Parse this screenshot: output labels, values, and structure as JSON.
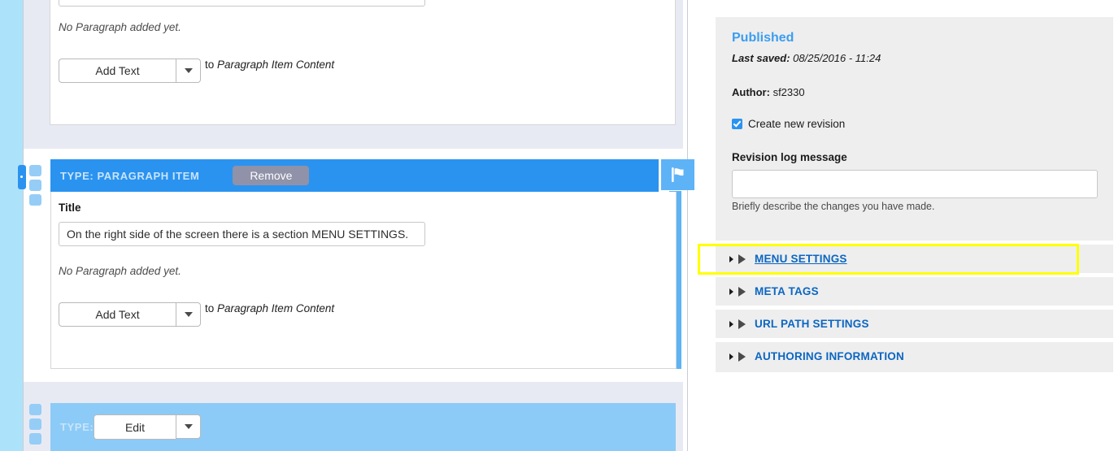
{
  "left_rail": {
    "icon": "drag-rail"
  },
  "main": {
    "top_card": {
      "top_input_value": "",
      "empty_notice": "No Paragraph added yet.",
      "add_button_label": "Add Text",
      "add_button_caret": "chevron-down-icon",
      "to_prefix": "to ",
      "to_target": "Paragraph Item Content"
    },
    "active_item": {
      "type_label": "TYPE: PARAGRAPH ITEM",
      "remove_label": "Remove",
      "flag_icon": "flag-icon",
      "title_field_label": "Title",
      "title_value": "On the right side of the screen there is a section MENU SETTINGS.",
      "empty_notice": "No Paragraph added yet.",
      "add_button_label": "Add Text",
      "add_button_caret": "chevron-down-icon",
      "to_prefix": "to ",
      "to_target": "Paragraph Item Content",
      "drag_handle_icon": "drag-handle-icon"
    },
    "bottom_item": {
      "type_label": "TYPE: PARAGRAPH ITEM",
      "edit_label": "Edit",
      "edit_caret": "chevron-down-icon",
      "drag_handle_icon": "drag-handle-icon"
    }
  },
  "sidebar": {
    "status": "Published",
    "last_saved_label": "Last saved:",
    "last_saved_value": "08/25/2016 - 11:24",
    "author_label": "Author:",
    "author_value": "sf2330",
    "create_revision_label": "Create new revision",
    "create_revision_checked": true,
    "revision_log_label": "Revision log message",
    "revision_log_value": "",
    "revision_log_placeholder": "",
    "revision_help": "Briefly describe the changes you have made.",
    "accordions": [
      {
        "label": "MENU SETTINGS",
        "highlighted": true,
        "underlined": true
      },
      {
        "label": "META TAGS",
        "highlighted": false,
        "underlined": false
      },
      {
        "label": "URL PATH SETTINGS",
        "highlighted": false,
        "underlined": false
      },
      {
        "label": "AUTHORING INFORMATION",
        "highlighted": false,
        "underlined": false
      }
    ]
  },
  "colors": {
    "accent_blue": "#2a93f0",
    "light_blue": "#8ccbf7",
    "rail_cyan": "#ade3fa",
    "lavender": "#e8eaf3",
    "sidebar_gray": "#eeeeee",
    "link_blue": "#0b66c2",
    "highlight_yellow": "#ffff00",
    "remove_gray": "#8f92a8"
  }
}
